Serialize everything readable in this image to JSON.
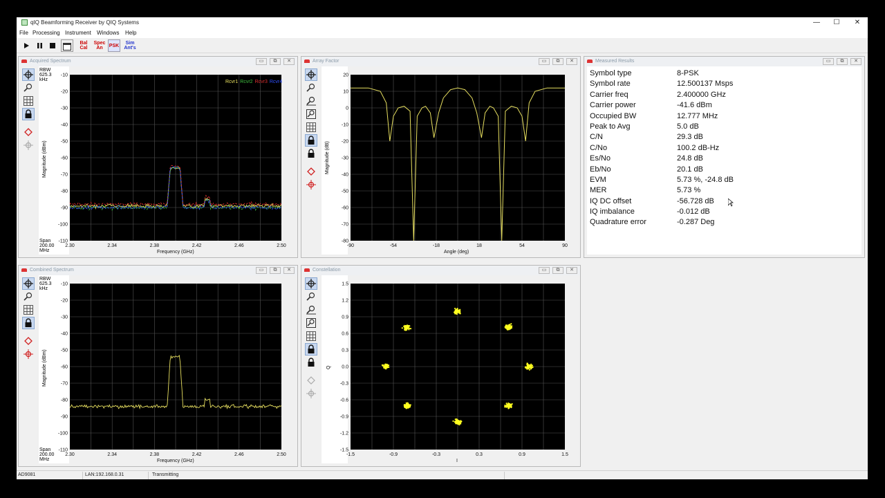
{
  "window": {
    "title": "qIQ Beamforming Receiver by QIQ Systems",
    "minimize": "—",
    "maximize": "☐",
    "close": "✕"
  },
  "menu": [
    "File",
    "Processing",
    "Instrument",
    "Windows",
    "Help"
  ],
  "toolbar": {
    "bal": [
      "Bal",
      "Cal"
    ],
    "spec": [
      "Spec",
      "An"
    ],
    "psk": "PSK",
    "sim": [
      "Sim",
      "Ant's"
    ]
  },
  "panels": {
    "acquired": {
      "title": "Acquired Spectrum",
      "rbw": [
        "RBW",
        "625.3",
        "kHz"
      ],
      "span": [
        "Span",
        "200.00",
        "MHz"
      ],
      "ylabel": "Magnitude (dBm)",
      "xlabel": "Frequency (GHz)",
      "legend": [
        {
          "name": "Rcvr1",
          "color": "#e8e060"
        },
        {
          "name": "Rcvr2",
          "color": "#40c040"
        },
        {
          "name": "Rcvr3",
          "color": "#e03030"
        },
        {
          "name": "Rcvr4",
          "color": "#3050ff"
        }
      ]
    },
    "array": {
      "title": "Array Factor",
      "ylabel": "Magnitude (dB)",
      "xlabel": "Angle (deg)"
    },
    "combined": {
      "title": "Combined Spectrum",
      "rbw": [
        "RBW",
        "625.3",
        "kHz"
      ],
      "span": [
        "Span",
        "200.00",
        "MHz"
      ],
      "ylabel": "Magnitude (dBm)",
      "xlabel": "Frequency (GHz)"
    },
    "constellation": {
      "title": "Constellation",
      "ylabel": "Q",
      "xlabel": "I"
    },
    "results": {
      "title": "Measured Results"
    }
  },
  "results": [
    {
      "k": "Symbol type",
      "v": "8-PSK"
    },
    {
      "k": "Symbol rate",
      "v": "12.500137 Msps"
    },
    {
      "k": "Carrier freq",
      "v": "2.400000 GHz"
    },
    {
      "k": "Carrier power",
      "v": "-41.6 dBm"
    },
    {
      "k": "Occupied BW",
      "v": "12.777 MHz"
    },
    {
      "k": "Peak to Avg",
      "v": "5.0 dB"
    },
    {
      "k": "C/N",
      "v": "29.3 dB"
    },
    {
      "k": "C/No",
      "v": "100.2 dB-Hz"
    },
    {
      "k": "Es/No",
      "v": "24.8 dB"
    },
    {
      "k": "Eb/No",
      "v": "20.1 dB"
    },
    {
      "k": "EVM",
      "v": "5.73 %, -24.8 dB"
    },
    {
      "k": "MER",
      "v": "5.73 %"
    },
    {
      "k": "IQ DC offset",
      "v": "-56.728 dB"
    },
    {
      "k": "IQ imbalance",
      "v": "-0.012 dB"
    },
    {
      "k": "Quadrature error",
      "v": "-0.287 Deg"
    }
  ],
  "status": {
    "device": "AD9081",
    "lan": "LAN:192.168.0.31",
    "state": "Transmitting"
  },
  "chart_data": [
    {
      "type": "line",
      "panel": "acquired",
      "xlabel": "Frequency (GHz)",
      "ylabel": "Magnitude (dBm)",
      "xlim": [
        2.3,
        2.5
      ],
      "ylim": [
        -110,
        -10
      ],
      "grid": true,
      "xticks": [
        "2.30",
        "2.34",
        "2.38",
        "2.42",
        "2.46",
        "2.50"
      ],
      "yticks": [
        "-10",
        "-20",
        "-30",
        "-40",
        "-50",
        "-60",
        "-70",
        "-80",
        "-90",
        "-100",
        "-110"
      ],
      "series": [
        {
          "name": "Rcvr1",
          "color": "#e8e060",
          "floor": -89,
          "peak": -66,
          "band": [
            2.392,
            2.407
          ]
        },
        {
          "name": "Rcvr2",
          "color": "#40c040",
          "floor": -90,
          "peak": -66,
          "band": [
            2.392,
            2.407
          ]
        },
        {
          "name": "Rcvr3",
          "color": "#e03030",
          "floor": -88,
          "peak": -65,
          "band": [
            2.392,
            2.407
          ]
        },
        {
          "name": "Rcvr4",
          "color": "#3050ff",
          "floor": -90,
          "peak": -66,
          "band": [
            2.392,
            2.407
          ]
        }
      ]
    },
    {
      "type": "line",
      "panel": "array",
      "xlabel": "Angle (deg)",
      "ylabel": "Magnitude (dB)",
      "xlim": [
        -90,
        90
      ],
      "ylim": [
        -80,
        20
      ],
      "grid": true,
      "xticks": [
        "-90",
        "-54",
        "-18",
        "18",
        "54",
        "90"
      ],
      "yticks": [
        "20",
        "10",
        "0",
        "-10",
        "-20",
        "-30",
        "-40",
        "-50",
        "-60",
        "-70",
        "-80"
      ],
      "series": [
        {
          "color": "#e8e060",
          "points": [
            [
              -90,
              12
            ],
            [
              -75,
              12
            ],
            [
              -65,
              10
            ],
            [
              -60,
              3
            ],
            [
              -57,
              -20
            ],
            [
              -54,
              -5
            ],
            [
              -50,
              0
            ],
            [
              -45,
              1
            ],
            [
              -40,
              -2
            ],
            [
              -37,
              -80
            ],
            [
              -34,
              -5
            ],
            [
              -30,
              0
            ],
            [
              -27,
              1
            ],
            [
              -23,
              -3
            ],
            [
              -20,
              -18
            ],
            [
              -16,
              -3
            ],
            [
              -12,
              6
            ],
            [
              -6,
              11
            ],
            [
              0,
              12
            ],
            [
              6,
              11
            ],
            [
              12,
              6
            ],
            [
              16,
              -3
            ],
            [
              20,
              -18
            ],
            [
              23,
              -3
            ],
            [
              27,
              1
            ],
            [
              30,
              0
            ],
            [
              34,
              -5
            ],
            [
              37,
              -80
            ],
            [
              40,
              -2
            ],
            [
              45,
              1
            ],
            [
              50,
              0
            ],
            [
              54,
              -5
            ],
            [
              57,
              -20
            ],
            [
              60,
              3
            ],
            [
              65,
              10
            ],
            [
              75,
              12
            ],
            [
              90,
              12
            ]
          ]
        }
      ]
    },
    {
      "type": "line",
      "panel": "combined",
      "xlabel": "Frequency (GHz)",
      "ylabel": "Magnitude (dBm)",
      "xlim": [
        2.3,
        2.5
      ],
      "ylim": [
        -110,
        -10
      ],
      "grid": true,
      "xticks": [
        "2.30",
        "2.34",
        "2.38",
        "2.42",
        "2.46",
        "2.50"
      ],
      "yticks": [
        "-10",
        "-20",
        "-30",
        "-40",
        "-50",
        "-60",
        "-70",
        "-80",
        "-90",
        "-100",
        "-110"
      ],
      "series": [
        {
          "color": "#e8e060",
          "floor": -84,
          "peak": -54,
          "band": [
            2.392,
            2.407
          ]
        }
      ]
    },
    {
      "type": "scatter",
      "panel": "constellation",
      "xlabel": "I",
      "ylabel": "Q",
      "xlim": [
        -1.5,
        1.5
      ],
      "ylim": [
        -1.5,
        1.5
      ],
      "grid": true,
      "xticks": [
        "-1.5",
        "-0.9",
        "-0.3",
        "0.3",
        "0.9",
        "1.5"
      ],
      "yticks": [
        "1.5",
        "1.2",
        "0.9",
        "0.6",
        "0.3",
        "0.0",
        "-0.3",
        "-0.6",
        "-0.9",
        "-1.2",
        "-1.5"
      ],
      "series": [
        {
          "color": "#ffff20",
          "clusters": [
            [
              0.0,
              1.0
            ],
            [
              0.71,
              0.71
            ],
            [
              1.0,
              0.0
            ],
            [
              0.71,
              -0.71
            ],
            [
              0.0,
              -1.0
            ],
            [
              -0.71,
              -0.71
            ],
            [
              -1.0,
              0.0
            ],
            [
              -0.71,
              0.71
            ]
          ]
        }
      ]
    }
  ]
}
